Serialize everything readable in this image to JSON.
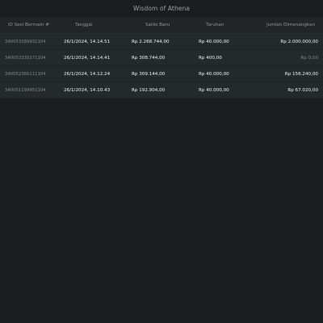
{
  "window": {
    "title": "Wisdom of Athena"
  },
  "table": {
    "headers": {
      "id": "ID Sesi Bermain #",
      "date": "Tanggal",
      "balance": "Saldo Baru",
      "bet": "Taruhan",
      "win": "Jumlah Dimenangkan"
    },
    "rows": [
      {
        "id": "340053389931104",
        "date": "26/1/2024, 14.14.51",
        "balance": "Rp 2.268.744,00",
        "bet": "Rp 40.000,00",
        "win": "Rp 2.000.000,00"
      },
      {
        "id": "340053335271104",
        "date": "26/1/2024, 14.14.41",
        "balance": "Rp 308.744,00",
        "bet": "Rp 400,00",
        "win": "Rp 0,00"
      },
      {
        "id": "340052366111104",
        "date": "26/1/2024, 14.12.24",
        "balance": "Rp 309.144,00",
        "bet": "Rp 40.000,00",
        "win": "Rp 156.240,00"
      },
      {
        "id": "340051199951104",
        "date": "26/1/2024, 14.10.43",
        "balance": "Rp 192.904,00",
        "bet": "Rp 40.000,00",
        "win": "Rp 67.020,00"
      }
    ]
  }
}
